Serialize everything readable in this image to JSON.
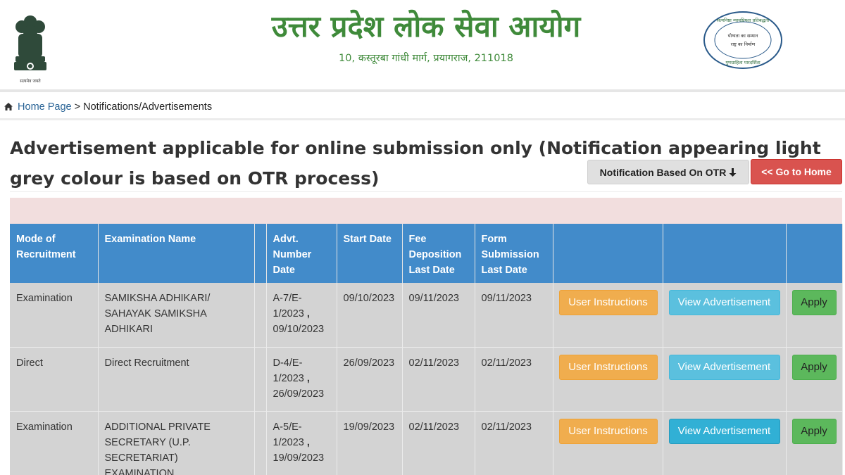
{
  "header": {
    "org_title": "उत्तर प्रदेश लोक सेवा आयोग",
    "address": "10, कस्तूरबा गांधी मार्ग, प्रयागराज, 211018",
    "emblem_caption": "सत्यमेव जयते",
    "seal_text": [
      "सत्यनिष्ठा न्यायप्रियता प्रतिबद्धता",
      "योग्यता का सम्मान",
      "राष्ट्र का निर्माण",
      "गुणग्राहिता पारदर्शिता"
    ]
  },
  "breadcrumb": {
    "home_label": "Home Page",
    "separator": ">",
    "current": "Notifications/Advertisements"
  },
  "page": {
    "heading": "Advertisement applicable for online submission only (Notification appearing light grey colour is based on OTR process)",
    "otr_button": "Notification Based On OTR",
    "home_button": "<< Go to Home"
  },
  "table": {
    "headers": [
      "Mode of Recruitment",
      "Examination Name",
      "",
      "Advt. Number Date",
      "Start Date",
      "Fee Deposition Last Date",
      "Form Submission Last Date",
      "",
      "",
      ""
    ],
    "button_labels": {
      "instructions": "User Instructions",
      "advertisement": "View Advertisement",
      "apply": "Apply"
    },
    "rows": [
      {
        "mode": "Examination",
        "exam_name": "SAMIKSHA ADHIKARI/ SAHAYAK SAMIKSHA ADHIKARI",
        "advt_number": "A-7/E-1/2023",
        "advt_date": "09/10/2023",
        "start_date": "09/10/2023",
        "fee_last_date": "09/11/2023",
        "form_last_date": "09/11/2023"
      },
      {
        "mode": "Direct",
        "exam_name": "Direct Recruitment",
        "advt_number": "D-4/E-1/2023",
        "advt_date": "26/09/2023",
        "start_date": "26/09/2023",
        "fee_last_date": "02/11/2023",
        "form_last_date": "02/11/2023"
      },
      {
        "mode": "Examination",
        "exam_name": "ADDITIONAL PRIVATE SECRETARY (U.P. SECRETARIAT) EXAMINATION",
        "advt_number": "A-5/E-1/2023",
        "advt_date": "19/09/2023",
        "start_date": "19/09/2023",
        "fee_last_date": "02/11/2023",
        "form_last_date": "02/11/2023"
      }
    ]
  },
  "colors": {
    "brand_green": "#3f8a3a",
    "table_header": "#428bca",
    "row_grey": "#d3d3d3",
    "alert_pink": "#f2dede",
    "danger": "#d9534f",
    "warning": "#f0ad4e",
    "info": "#5bc0de",
    "success": "#5cb85c"
  },
  "icons": {
    "breadcrumb_home": "home-icon",
    "otr_arrow": "arrow-down-icon",
    "left_logo": "national-emblem",
    "right_logo": "commission-seal"
  }
}
